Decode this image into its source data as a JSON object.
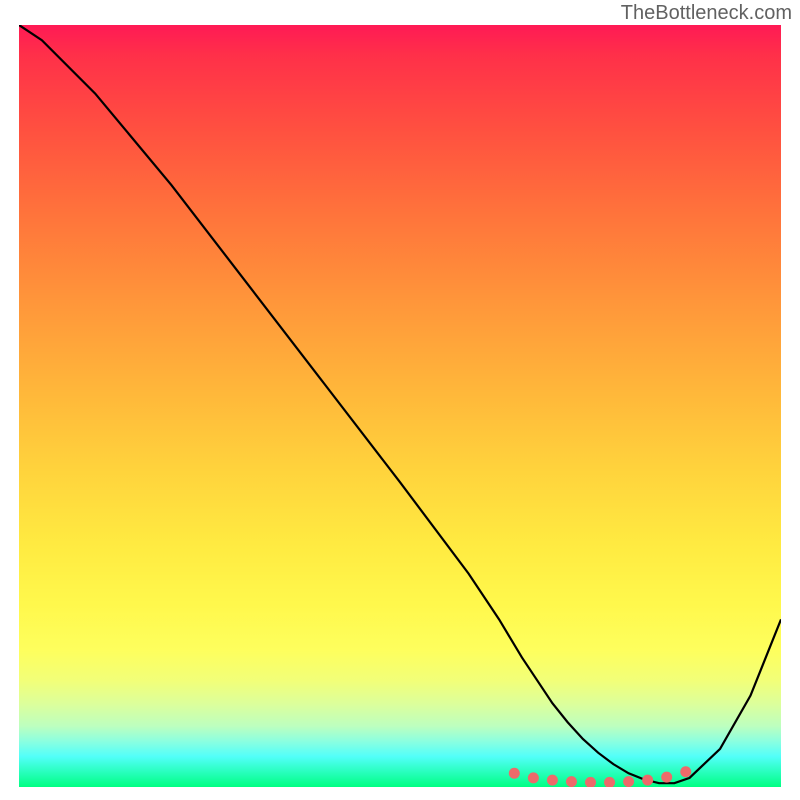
{
  "watermark": "TheBottleneck.com",
  "chart_data": {
    "type": "line",
    "title": "",
    "xlabel": "",
    "ylabel": "",
    "xlim": [
      0,
      100
    ],
    "ylim": [
      0,
      100
    ],
    "series": [
      {
        "name": "curve",
        "x": [
          0,
          3,
          10,
          20,
          30,
          40,
          50,
          59,
          63,
          66,
          68,
          70,
          72,
          74,
          76,
          78,
          80,
          82,
          84,
          86,
          88,
          92,
          96,
          100
        ],
        "values": [
          100,
          98,
          91,
          79,
          66,
          53,
          40,
          28,
          22,
          17,
          14,
          11,
          8.5,
          6.3,
          4.5,
          3.0,
          1.8,
          1.0,
          0.5,
          0.5,
          1.2,
          5.0,
          12,
          22
        ],
        "color": "#000000"
      }
    ],
    "markers": {
      "name": "dots",
      "x": [
        65,
        67.5,
        70,
        72.5,
        75,
        77.5,
        80,
        82.5,
        85,
        87.5
      ],
      "values": [
        1.8,
        1.2,
        0.9,
        0.7,
        0.6,
        0.6,
        0.7,
        0.9,
        1.3,
        2.0
      ],
      "color": "#ed6a6a",
      "size": 5.5
    }
  }
}
